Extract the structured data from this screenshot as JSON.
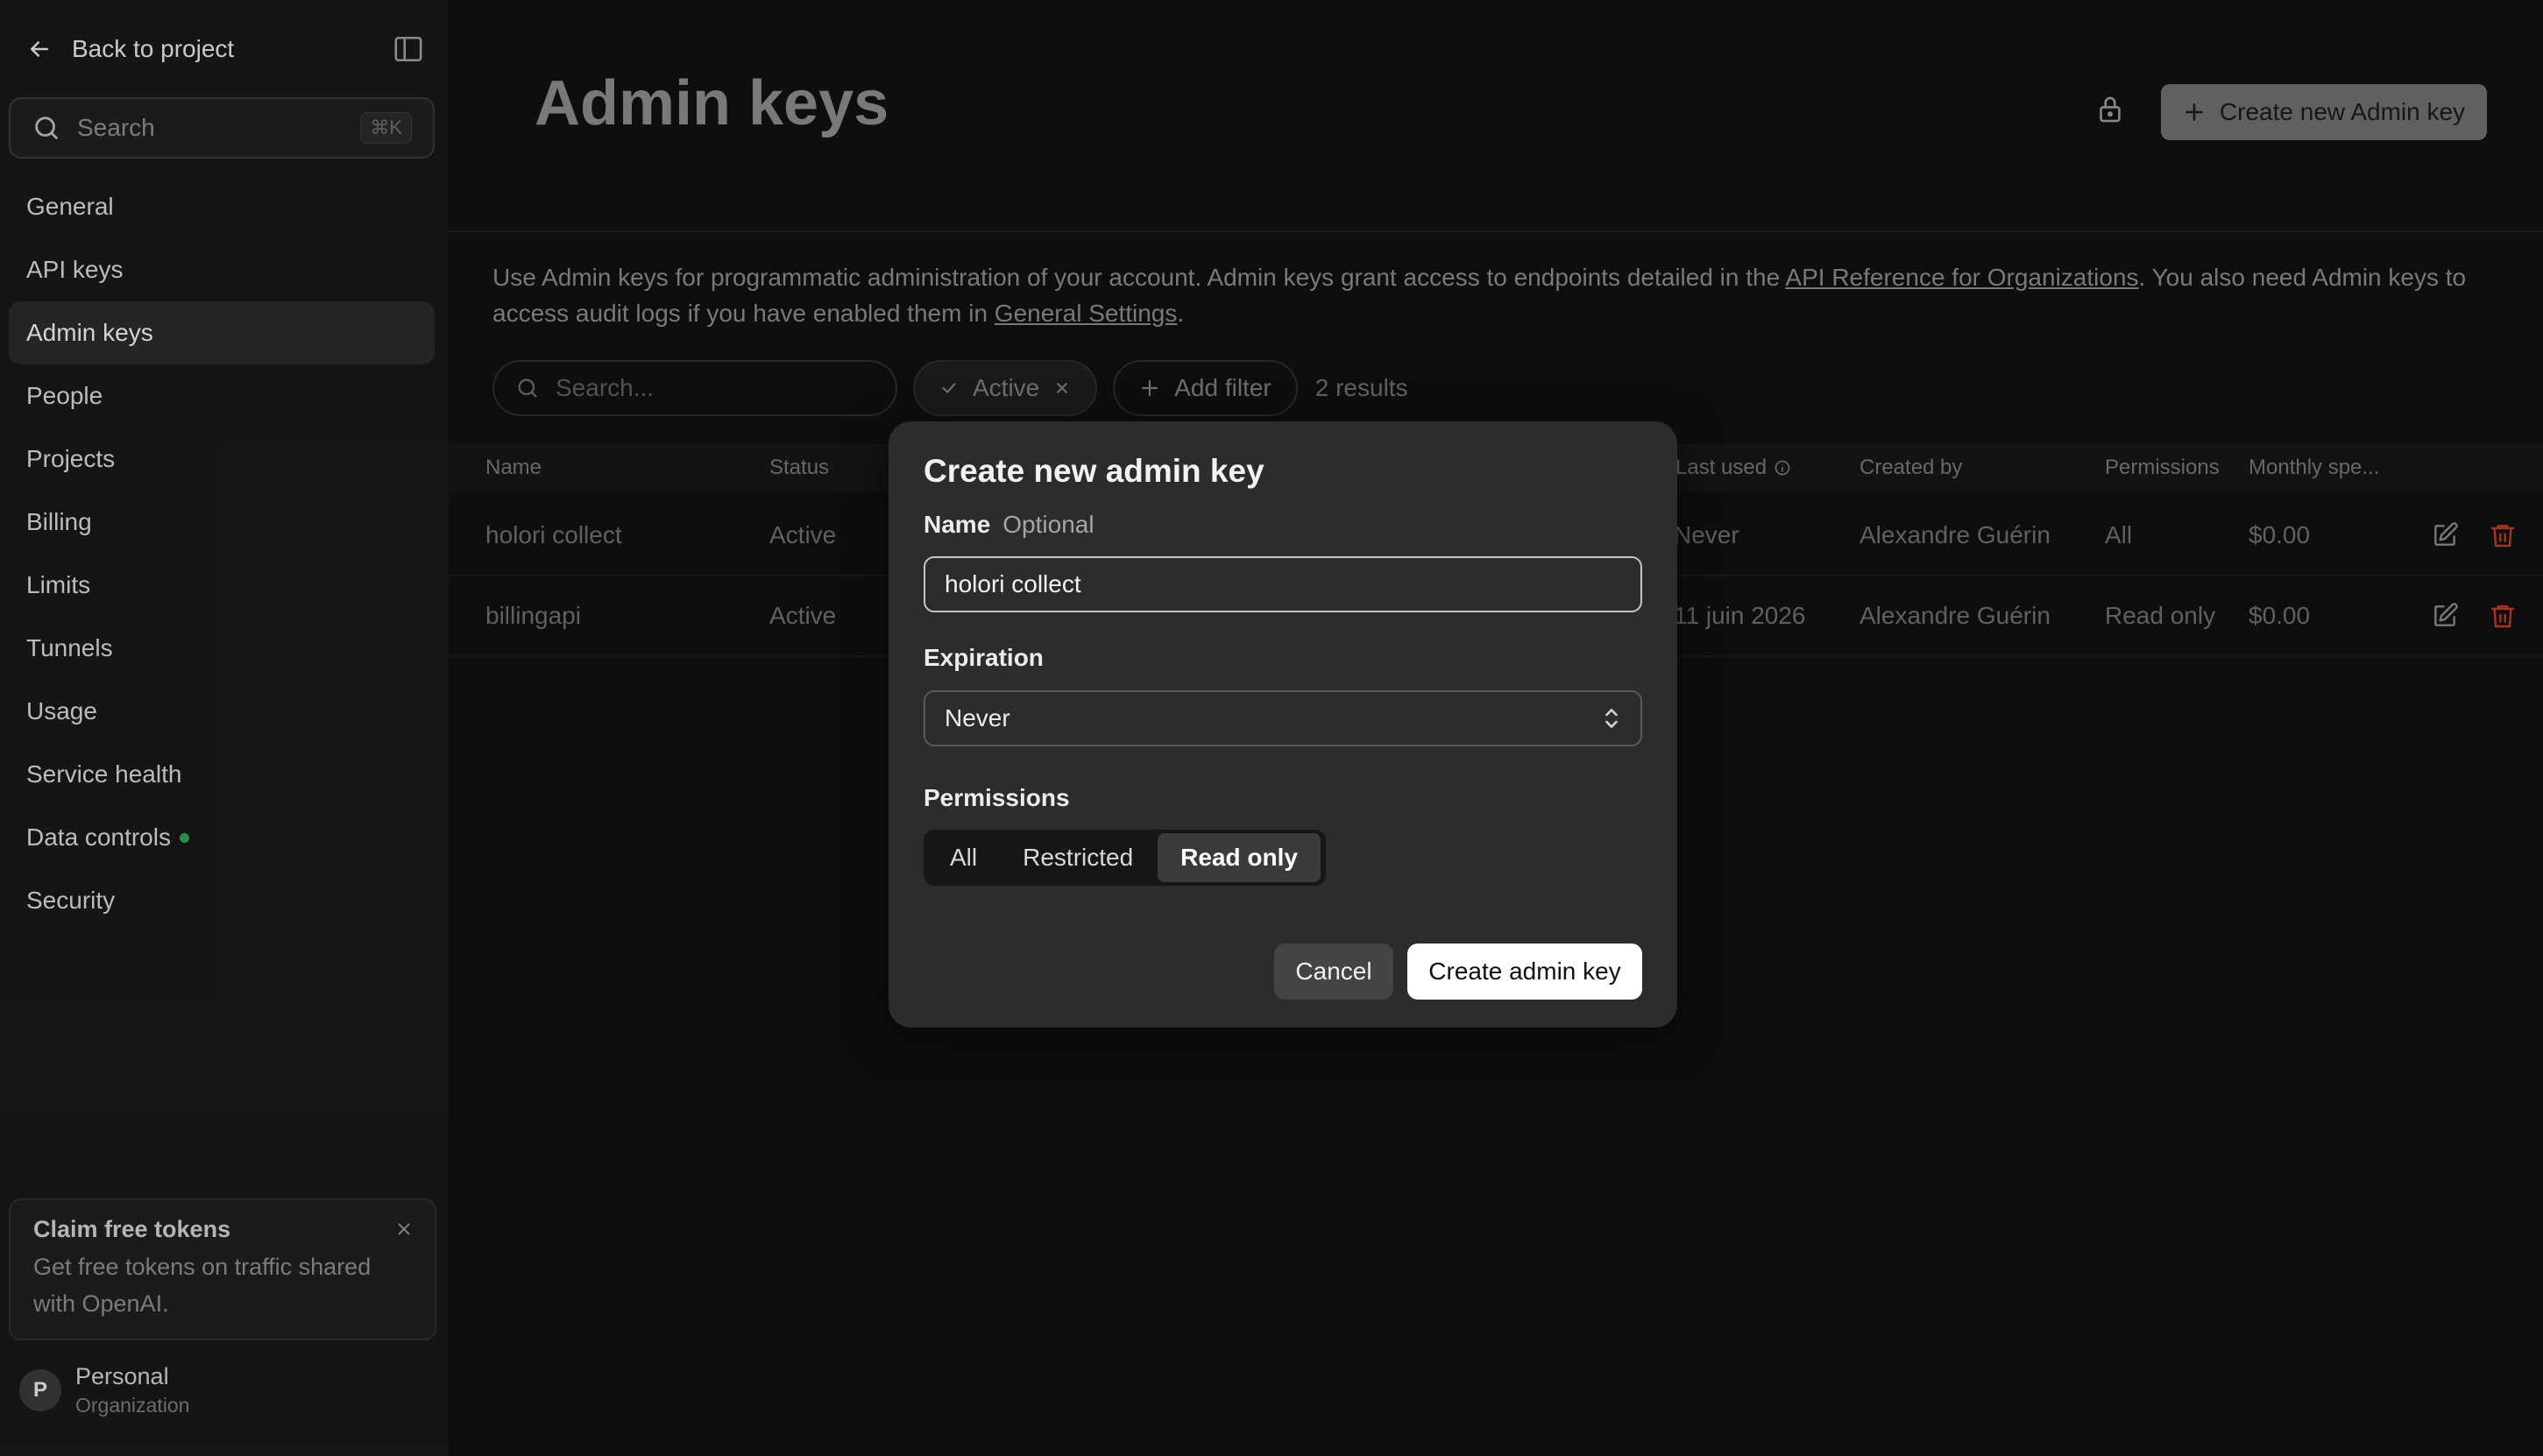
{
  "sidebar": {
    "back_label": "Back to project",
    "search_placeholder": "Search",
    "search_shortcut": "⌘K",
    "items": [
      {
        "label": "General"
      },
      {
        "label": "API keys"
      },
      {
        "label": "Admin keys"
      },
      {
        "label": "People"
      },
      {
        "label": "Projects"
      },
      {
        "label": "Billing"
      },
      {
        "label": "Limits"
      },
      {
        "label": "Tunnels"
      },
      {
        "label": "Usage"
      },
      {
        "label": "Service health"
      },
      {
        "label": "Data controls"
      },
      {
        "label": "Security"
      }
    ],
    "active_item": "Admin keys",
    "promo": {
      "title": "Claim free tokens",
      "text": "Get free tokens on traffic shared with OpenAI."
    },
    "org": {
      "initial": "P",
      "name": "Personal",
      "type": "Organization"
    }
  },
  "header": {
    "title": "Admin keys",
    "create_button": "Create new Admin key"
  },
  "description": {
    "part1": "Use Admin keys for programmatic administration of your account. Admin keys grant access to endpoints detailed in the ",
    "link1": "API Reference for Organizations",
    "part2": ". You also need Admin keys to access audit logs if you have enabled them in ",
    "link2": "General Settings",
    "part3": "."
  },
  "toolbar": {
    "search_placeholder": "Search...",
    "active_filter": "Active",
    "add_filter": "Add filter",
    "results": "2 results"
  },
  "table": {
    "columns": [
      "Name",
      "Status",
      "Last used",
      "Created by",
      "Permissions",
      "Monthly spe..."
    ],
    "rows": [
      {
        "name": "holori collect",
        "status": "Active",
        "last_used": "Never",
        "created_by": "Alexandre Guérin",
        "permissions": "All",
        "spend": "$0.00"
      },
      {
        "name": "billingapi",
        "status": "Active",
        "last_used": "11 juin 2026",
        "created_by": "Alexandre Guérin",
        "permissions": "Read only",
        "spend": "$0.00"
      }
    ]
  },
  "modal": {
    "title": "Create new admin key",
    "name_label": "Name",
    "name_optional": "Optional",
    "name_value": "holori collect",
    "expiration_label": "Expiration",
    "expiration_value": "Never",
    "permissions_label": "Permissions",
    "permission_options": [
      "All",
      "Restricted",
      "Read only"
    ],
    "permission_selected": "Read only",
    "cancel_label": "Cancel",
    "create_label": "Create admin key"
  },
  "colors": {
    "danger": "#c0392b",
    "status_dot": "#2ea44f"
  }
}
